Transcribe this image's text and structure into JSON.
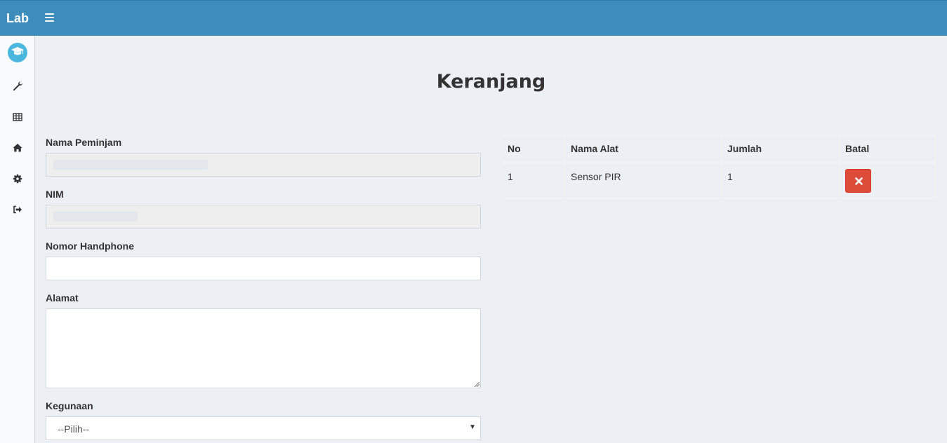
{
  "header": {
    "brand": "Lab",
    "menu_icon": "bars-icon"
  },
  "sidebar": {
    "logo_icon": "graduation-cap-icon",
    "items": [
      {
        "icon": "wrench-icon"
      },
      {
        "icon": "table-icon"
      },
      {
        "icon": "home-icon"
      },
      {
        "icon": "gear-icon"
      },
      {
        "icon": "sign-out-icon"
      }
    ]
  },
  "page": {
    "title": "Keranjang"
  },
  "form": {
    "nama_label": "Nama Peminjam",
    "nim_label": "NIM",
    "phone_label": "Nomor Handphone",
    "phone_value": "",
    "alamat_label": "Alamat",
    "alamat_value": "",
    "kegunaan_label": "Kegunaan",
    "kegunaan_selected": "--Pilih--"
  },
  "cart": {
    "headers": [
      "No",
      "Nama Alat",
      "Jumlah",
      "Batal"
    ],
    "rows": [
      {
        "no": "1",
        "nama_alat": "Sensor PIR",
        "jumlah": "1",
        "action_icon": "times-icon"
      }
    ]
  },
  "colors": {
    "header": "#3c8dbc",
    "danger": "#dd4b39",
    "logo": "#4bb6de",
    "background": "#ecf0f5"
  }
}
